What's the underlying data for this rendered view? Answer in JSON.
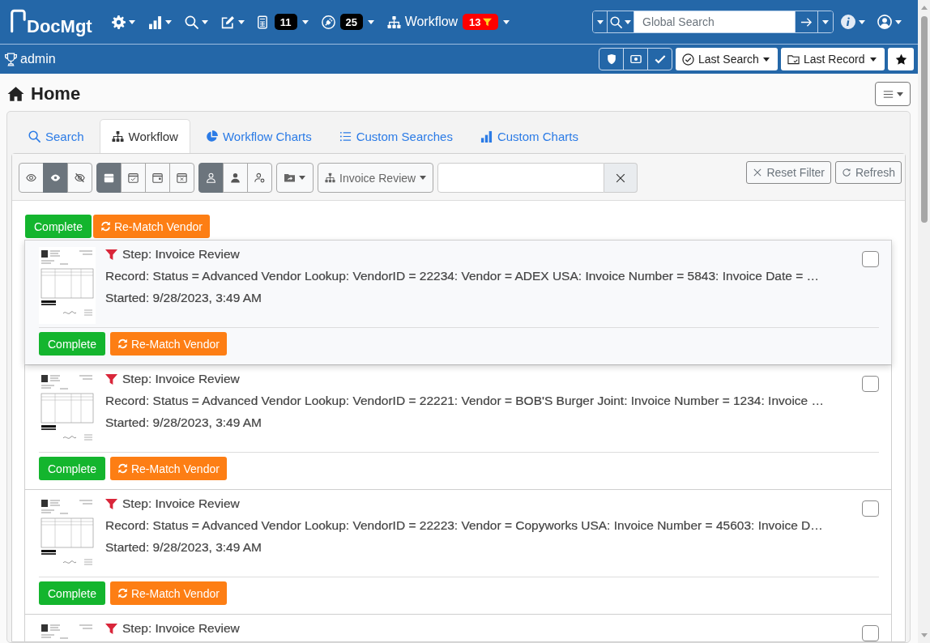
{
  "navbar": {
    "logo": "DocMgt",
    "menus": [
      {
        "kind": "icon"
      },
      {
        "kind": "icon"
      },
      {
        "kind": "icon"
      },
      {
        "kind": "icon"
      },
      {
        "kind": "badge",
        "badge": "11",
        "color": "#000000"
      },
      {
        "kind": "badge",
        "badge": "25",
        "color": "#000000"
      },
      {
        "kind": "label",
        "label": "Workflow",
        "badge": "13",
        "color": "#ff0000"
      }
    ],
    "global_search": {
      "placeholder": "Global Search"
    }
  },
  "userbar": {
    "user": "admin",
    "history": [
      {
        "label": "Last Search"
      },
      {
        "label": "Last Record"
      }
    ]
  },
  "page": {
    "title": "Home"
  },
  "tabs": [
    {
      "label": "Search",
      "selected": false
    },
    {
      "label": "Workflow",
      "selected": true
    },
    {
      "label": "Workflow Charts",
      "selected": false
    },
    {
      "label": "Custom Searches",
      "selected": false
    },
    {
      "label": "Custom Charts",
      "selected": false
    }
  ],
  "toolbar": {
    "toggle_groups": [
      [
        {
          "selected": false
        },
        {
          "selected": true
        },
        {
          "selected": false
        }
      ],
      [
        {
          "selected": true
        },
        {
          "selected": false
        },
        {
          "selected": false
        },
        {
          "selected": false
        }
      ],
      [
        {
          "selected": true
        },
        {
          "selected": false
        },
        {
          "selected": false
        }
      ]
    ],
    "workflow_filter": "Invoice Review",
    "reset_button": "Reset Filter",
    "refresh_button": "Refresh"
  },
  "bulk_actions": [
    {
      "kind": "complete",
      "label": "Complete"
    },
    {
      "kind": "rematch",
      "label": "Re-Match Vendor"
    }
  ],
  "tasks": [
    {
      "step": "Step: Invoice Review",
      "record": "Record: Status = Advanced Vendor Lookup: VendorID = 22234: Vendor = ADEX USA: Invoice Number = 5843: Invoice Date = …",
      "started": "Started: 9/28/2023, 3:49 AM",
      "checked": false,
      "highlighted": true,
      "actions": [
        {
          "kind": "complete",
          "label": "Complete"
        },
        {
          "kind": "rematch",
          "label": "Re-Match Vendor"
        }
      ]
    },
    {
      "step": "Step: Invoice Review",
      "record": "Record: Status = Advanced Vendor Lookup: VendorID = 22221: Vendor = BOB'S Burger Joint: Invoice Number = 1234: Invoice …",
      "started": "Started: 9/28/2023, 3:49 AM",
      "checked": false,
      "highlighted": false,
      "actions": [
        {
          "kind": "complete",
          "label": "Complete"
        },
        {
          "kind": "rematch",
          "label": "Re-Match Vendor"
        }
      ]
    },
    {
      "step": "Step: Invoice Review",
      "record": "Record: Status = Advanced Vendor Lookup: VendorID = 22223: Vendor = Copyworks USA: Invoice Number = 45603: Invoice D…",
      "started": "Started: 9/28/2023, 3:49 AM",
      "checked": false,
      "highlighted": false,
      "actions": [
        {
          "kind": "complete",
          "label": "Complete"
        },
        {
          "kind": "rematch",
          "label": "Re-Match Vendor"
        }
      ]
    },
    {
      "step": "Step: Invoice Review",
      "checked": false,
      "highlighted": false
    }
  ]
}
